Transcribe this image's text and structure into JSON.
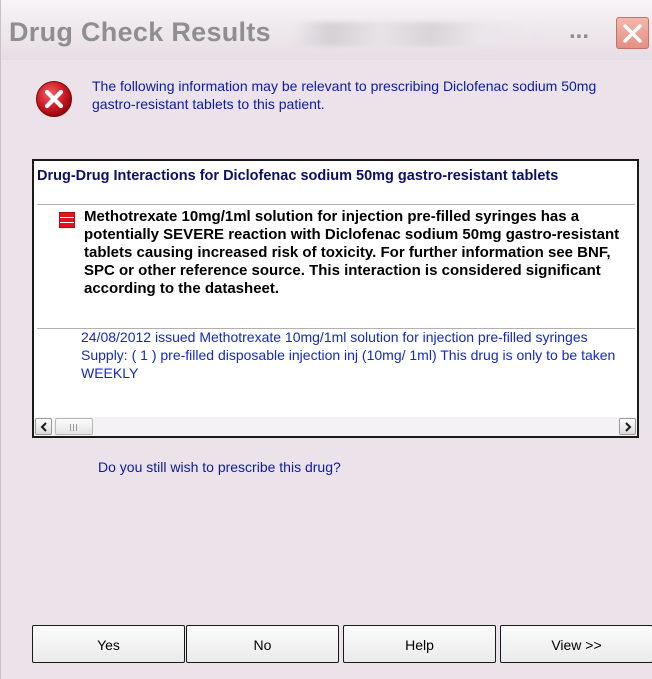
{
  "window": {
    "title": "Drug Check Results",
    "title_ellipsis": "...",
    "close_icon": "close-x"
  },
  "message": {
    "icon": "error-icon",
    "text": "The following information may be relevant to prescribing Diclofenac sodium 50mg gastro-resistant tablets to this patient."
  },
  "results": {
    "header": "Drug-Drug Interactions for Diclofenac sodium 50mg gastro-resistant tablets",
    "interaction": {
      "severity_icon": "severe-flag-icon",
      "text": "Methotrexate 10mg/1ml solution for injection pre-filled syringes has a potentially SEVERE reaction with Diclofenac sodium 50mg gastro-resistant tablets causing increased risk of toxicity. For further information see BNF, SPC or other reference source. This interaction is considered significant according to the datasheet."
    },
    "issue": "24/08/2012  issued Methotrexate 10mg/1ml solution for injection pre-filled syringes  Supply: ( 1 )  pre-filled disposable injection inj (10mg/ 1ml)  This drug is only to be taken WEEKLY"
  },
  "question": "Do you still wish to prescribe this drug?",
  "buttons": {
    "yes": "Yes",
    "no": "No",
    "help": "Help",
    "view": "View >>"
  },
  "colors": {
    "dialog_bg": "#ece3ea",
    "info_text": "#0a1aa6",
    "issue_text": "#1428c8",
    "header_text": "#0d0d6b",
    "error_red": "#c8141e"
  }
}
